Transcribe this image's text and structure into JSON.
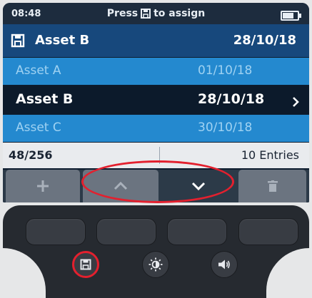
{
  "status_bar": {
    "time": "08:48",
    "instruction_pre": "Press",
    "instruction_post": "to assign",
    "battery_level": 0.75
  },
  "header": {
    "asset": "Asset B",
    "date": "28/10/18"
  },
  "list": {
    "rows": [
      {
        "name": "Asset A",
        "date": "01/10/18",
        "selected": false
      },
      {
        "name": "Asset B",
        "date": "28/10/18",
        "selected": true
      },
      {
        "name": "Asset C",
        "date": "30/10/18",
        "selected": false
      }
    ]
  },
  "footer": {
    "count": "48/256",
    "entries": "10 Entries"
  },
  "softkeys": [
    {
      "icon": "plus-icon"
    },
    {
      "icon": "chevron-up-icon"
    },
    {
      "icon": "chevron-down-icon",
      "active": true
    },
    {
      "icon": "trash-icon"
    }
  ],
  "hardware_buttons": [
    {
      "icon": "save-icon",
      "highlighted": true
    },
    {
      "icon": "brightness-icon"
    },
    {
      "icon": "volume-icon"
    }
  ],
  "colors": {
    "header": "#17487c",
    "row_normal": "#2489cf",
    "row_selected": "#0c1a2b",
    "highlight": "#e3202e"
  }
}
